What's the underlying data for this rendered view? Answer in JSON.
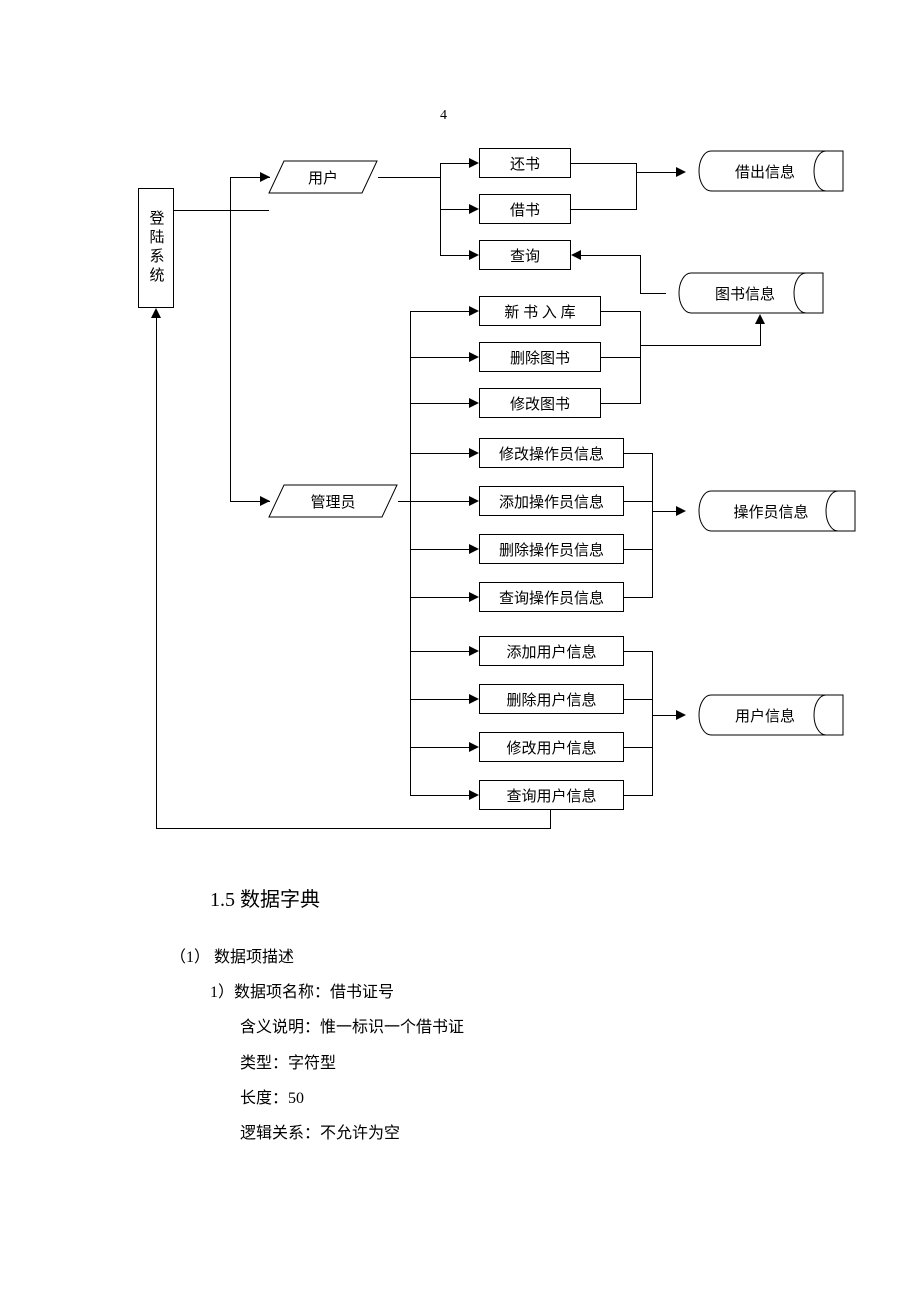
{
  "page_number": "4",
  "diagram": {
    "login_system": "登陆系统",
    "user": "用户",
    "admin": "管理员",
    "user_actions": {
      "return_book": "还书",
      "borrow_book": "借书",
      "query": "查询"
    },
    "book_ops": {
      "new_book": "新 书 入 库",
      "delete_book": "删除图书",
      "modify_book": "修改图书"
    },
    "operator_ops": {
      "modify_op": "修改操作员信息",
      "add_op": "添加操作员信息",
      "delete_op": "删除操作员信息",
      "query_op": "查询操作员信息"
    },
    "user_ops": {
      "add_user": "添加用户信息",
      "delete_user": "删除用户信息",
      "modify_user": "修改用户信息",
      "query_user": "查询用户信息"
    },
    "datastores": {
      "lend_info": "借出信息",
      "book_info": "图书信息",
      "operator_info": "操作员信息",
      "user_info": "用户信息"
    }
  },
  "text": {
    "section_title": "1.5 数据字典",
    "sub1": "（1） 数据项描述",
    "item1_title": "1）数据项名称：借书证号",
    "meaning": "含义说明：惟一标识一个借书证",
    "type": "类型：字符型",
    "length": "长度：50",
    "logic": "逻辑关系：不允许为空"
  }
}
